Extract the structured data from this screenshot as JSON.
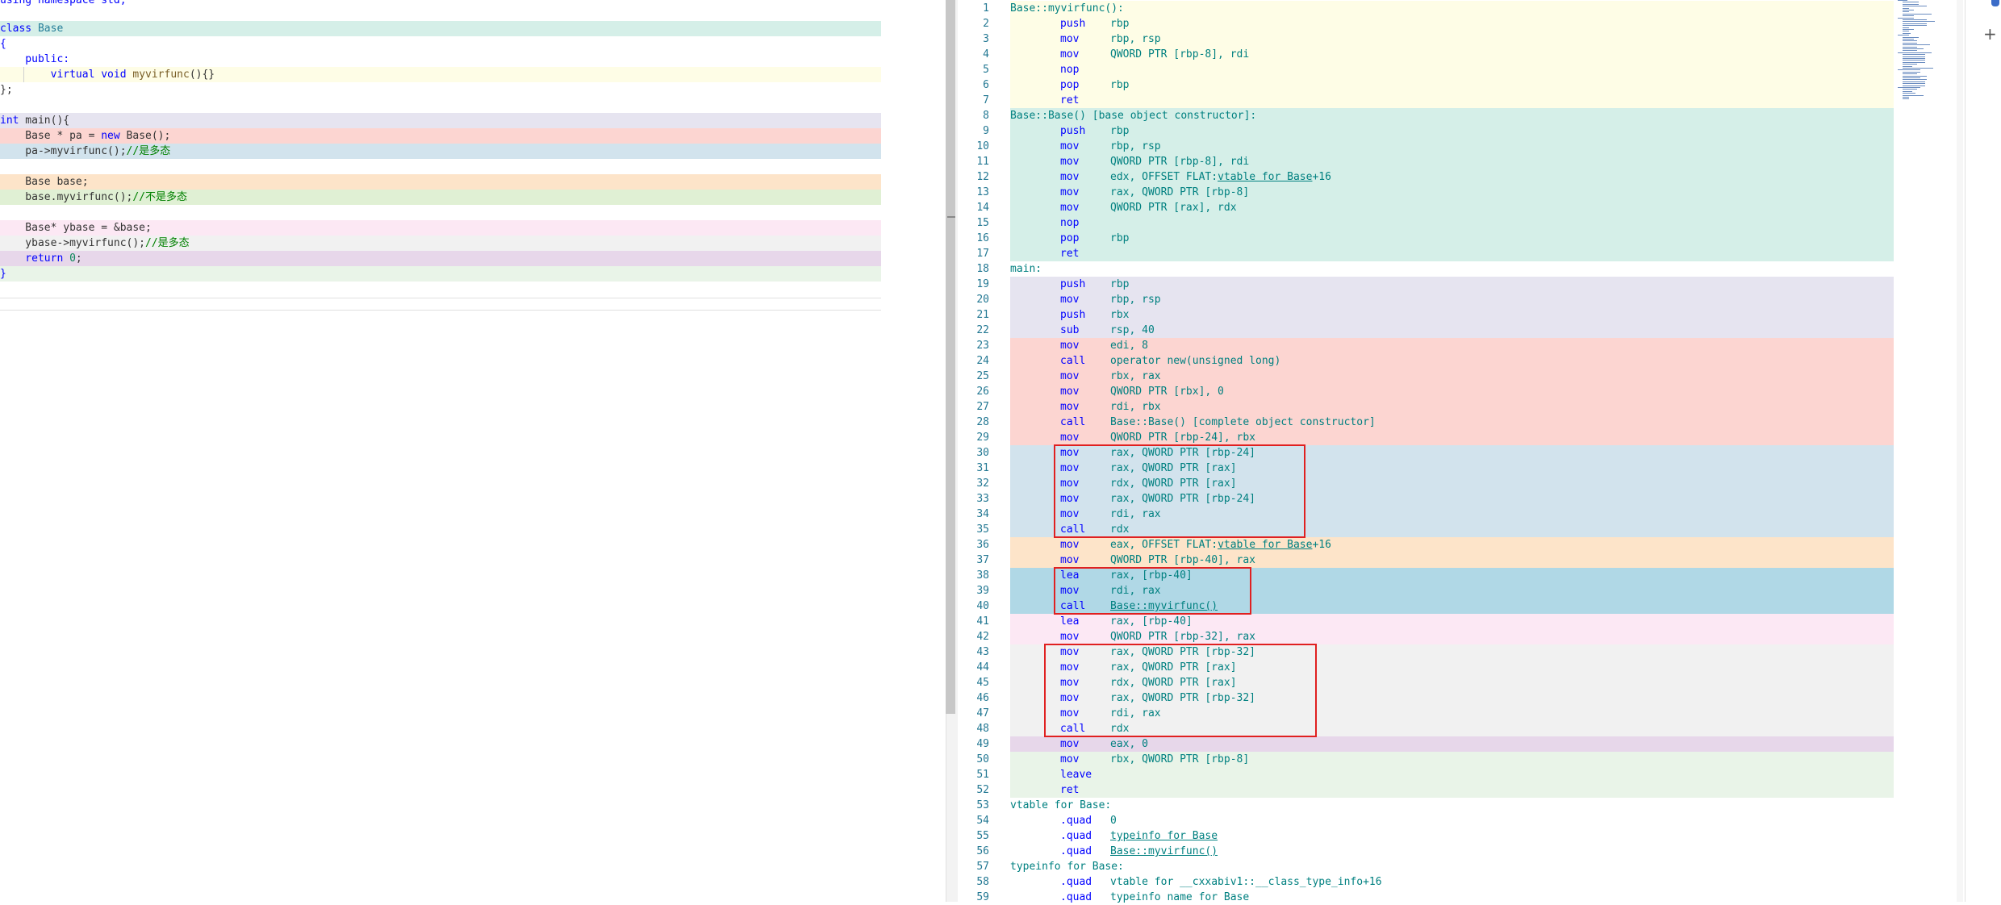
{
  "source": {
    "lines": [
      {
        "parts": [
          [
            "using namespace std;",
            "kw"
          ]
        ]
      },
      {
        "parts": [
          [
            "class",
            "kw"
          ],
          [
            " Base",
            "ty"
          ]
        ]
      },
      {
        "parts": [
          [
            "{",
            "kw"
          ]
        ]
      },
      {
        "parts": [
          [
            "    public:",
            "kw"
          ]
        ]
      },
      {
        "parts": [
          [
            "        virtual void ",
            "kw"
          ],
          [
            "myvirfunc",
            "fn"
          ],
          [
            "(){}",
            ""
          ]
        ]
      },
      {
        "parts": [
          [
            "};",
            ""
          ]
        ]
      },
      {
        "parts": [
          [
            "int",
            "kw"
          ],
          [
            " main(){",
            ""
          ]
        ]
      },
      {
        "parts": [
          [
            "    Base * pa = ",
            ""
          ],
          [
            "new",
            "kw"
          ],
          [
            " Base();",
            ""
          ]
        ]
      },
      {
        "parts": [
          [
            "    pa->myvirfunc();",
            ""
          ],
          [
            "//是多态",
            "cm"
          ]
        ]
      },
      {
        "parts": [
          [
            "    Base base;",
            ""
          ]
        ]
      },
      {
        "parts": [
          [
            "    base.myvirfunc();",
            ""
          ],
          [
            "//不是多态",
            "cm"
          ]
        ]
      },
      {
        "parts": [
          [
            "    Base* ybase = &base;",
            ""
          ]
        ]
      },
      {
        "parts": [
          [
            "    ybase->myvirfunc();",
            ""
          ],
          [
            "//是多态",
            "cm"
          ]
        ]
      },
      {
        "parts": [
          [
            "    return ",
            "kw"
          ],
          [
            "0",
            "nm"
          ],
          [
            ";",
            ""
          ]
        ]
      },
      {
        "parts": [
          [
            "}",
            "kw"
          ]
        ]
      }
    ]
  },
  "assembly": {
    "lines": [
      {
        "n": "1",
        "label": "Base::myvirfunc():"
      },
      {
        "n": "2",
        "op": "push",
        "args": "rbp"
      },
      {
        "n": "3",
        "op": "mov",
        "args": "rbp, rsp"
      },
      {
        "n": "4",
        "op": "mov",
        "args": "QWORD PTR [rbp-8], rdi"
      },
      {
        "n": "5",
        "op": "nop",
        "args": ""
      },
      {
        "n": "6",
        "op": "pop",
        "args": "rbp"
      },
      {
        "n": "7",
        "op": "ret",
        "args": ""
      },
      {
        "n": "8",
        "label": "Base::Base() [base object constructor]:"
      },
      {
        "n": "9",
        "op": "push",
        "args": "rbp"
      },
      {
        "n": "10",
        "op": "mov",
        "args": "rbp, rsp"
      },
      {
        "n": "11",
        "op": "mov",
        "args": "QWORD PTR [rbp-8], rdi"
      },
      {
        "n": "12",
        "op": "mov",
        "args": "edx, OFFSET FLAT:vtable for Base+16"
      },
      {
        "n": "13",
        "op": "mov",
        "args": "rax, QWORD PTR [rbp-8]"
      },
      {
        "n": "14",
        "op": "mov",
        "args": "QWORD PTR [rax], rdx"
      },
      {
        "n": "15",
        "op": "nop",
        "args": ""
      },
      {
        "n": "16",
        "op": "pop",
        "args": "rbp"
      },
      {
        "n": "17",
        "op": "ret",
        "args": ""
      },
      {
        "n": "18",
        "label": "main:"
      },
      {
        "n": "19",
        "op": "push",
        "args": "rbp"
      },
      {
        "n": "20",
        "op": "mov",
        "args": "rbp, rsp"
      },
      {
        "n": "21",
        "op": "push",
        "args": "rbx"
      },
      {
        "n": "22",
        "op": "sub",
        "args": "rsp, 40"
      },
      {
        "n": "23",
        "op": "mov",
        "args": "edi, 8"
      },
      {
        "n": "24",
        "op": "call",
        "args": "operator new(unsigned long)"
      },
      {
        "n": "25",
        "op": "mov",
        "args": "rbx, rax"
      },
      {
        "n": "26",
        "op": "mov",
        "args": "QWORD PTR [rbx], 0"
      },
      {
        "n": "27",
        "op": "mov",
        "args": "rdi, rbx"
      },
      {
        "n": "28",
        "op": "call",
        "args": "Base::Base() [complete object constructor]"
      },
      {
        "n": "29",
        "op": "mov",
        "args": "QWORD PTR [rbp-24], rbx"
      },
      {
        "n": "30",
        "op": "mov",
        "args": "rax, QWORD PTR [rbp-24]"
      },
      {
        "n": "31",
        "op": "mov",
        "args": "rax, QWORD PTR [rax]"
      },
      {
        "n": "32",
        "op": "mov",
        "args": "rdx, QWORD PTR [rax]"
      },
      {
        "n": "33",
        "op": "mov",
        "args": "rax, QWORD PTR [rbp-24]"
      },
      {
        "n": "34",
        "op": "mov",
        "args": "rdi, rax"
      },
      {
        "n": "35",
        "op": "call",
        "args": "rdx"
      },
      {
        "n": "36",
        "op": "mov",
        "args": "eax, OFFSET FLAT:vtable for Base+16"
      },
      {
        "n": "37",
        "op": "mov",
        "args": "QWORD PTR [rbp-40], rax"
      },
      {
        "n": "38",
        "op": "lea",
        "args": "rax, [rbp-40]"
      },
      {
        "n": "39",
        "op": "mov",
        "args": "rdi, rax"
      },
      {
        "n": "40",
        "op": "call",
        "args": "Base::myvirfunc()"
      },
      {
        "n": "41",
        "op": "lea",
        "args": "rax, [rbp-40]"
      },
      {
        "n": "42",
        "op": "mov",
        "args": "QWORD PTR [rbp-32], rax"
      },
      {
        "n": "43",
        "op": "mov",
        "args": "rax, QWORD PTR [rbp-32]"
      },
      {
        "n": "44",
        "op": "mov",
        "args": "rax, QWORD PTR [rax]"
      },
      {
        "n": "45",
        "op": "mov",
        "args": "rdx, QWORD PTR [rax]"
      },
      {
        "n": "46",
        "op": "mov",
        "args": "rax, QWORD PTR [rbp-32]"
      },
      {
        "n": "47",
        "op": "mov",
        "args": "rdi, rax"
      },
      {
        "n": "48",
        "op": "call",
        "args": "rdx"
      },
      {
        "n": "49",
        "op": "mov",
        "args": "eax, 0"
      },
      {
        "n": "50",
        "op": "mov",
        "args": "rbx, QWORD PTR [rbp-8]"
      },
      {
        "n": "51",
        "op": "leave",
        "args": ""
      },
      {
        "n": "52",
        "op": "ret",
        "args": ""
      },
      {
        "n": "53",
        "label": "vtable for Base:"
      },
      {
        "n": "54",
        "op": ".quad",
        "args": "0"
      },
      {
        "n": "55",
        "op": ".quad",
        "args": "typeinfo for Base"
      },
      {
        "n": "56",
        "op": ".quad",
        "args": "Base::myvirfunc()"
      },
      {
        "n": "57",
        "label": "typeinfo for Base:"
      },
      {
        "n": "58",
        "op": ".quad",
        "args": "vtable for __cxxabiv1::__class_type_info+16"
      },
      {
        "n": "59",
        "op": ".quad",
        "args": "typeinfo name for Base"
      }
    ]
  },
  "colors": {
    "yellow": "#fefde6",
    "teal": "#d5efe8",
    "lavender": "#e6e4f0",
    "salmon": "#fcd5d1",
    "blue": "#d2e3ed",
    "peach": "#fde4c9",
    "green": "#e0f0d4",
    "pink": "#fce8f4",
    "gray": "#f1f1f1",
    "purple": "#e7d7ea",
    "mint": "#e9f4e8",
    "darkblue": "#b0d8e6"
  },
  "icons": {
    "add": "+",
    "plus_icon": "plus-icon"
  }
}
